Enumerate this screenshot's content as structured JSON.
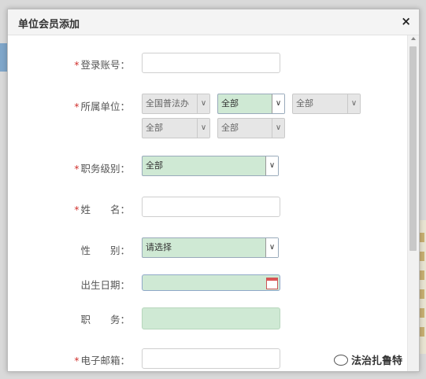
{
  "dialog": {
    "title": "单位会员添加",
    "close_symbol": "×"
  },
  "form": {
    "account_label": "登录账号：",
    "account_value": "",
    "unit_label": "所属单位：",
    "unit_selects": [
      "全国普法办",
      "全部",
      "全部",
      "全部",
      "全部"
    ],
    "level_label": "职务级别：",
    "level_value": "全部",
    "name_label": "姓　　名：",
    "name_value": "",
    "gender_label": "性　　别：",
    "gender_value": "请选择",
    "birth_label": "出生日期：",
    "birth_value": "",
    "position_label": "职　　务：",
    "position_value": "",
    "email_label": "电子邮箱：",
    "email_value": "",
    "required_mark": "*"
  },
  "watermark": {
    "text": "法治扎鲁特"
  },
  "colors": {
    "required": "#d0312d",
    "field_green": "#cfe9d4",
    "disabled_gray": "#e6e6e6"
  }
}
